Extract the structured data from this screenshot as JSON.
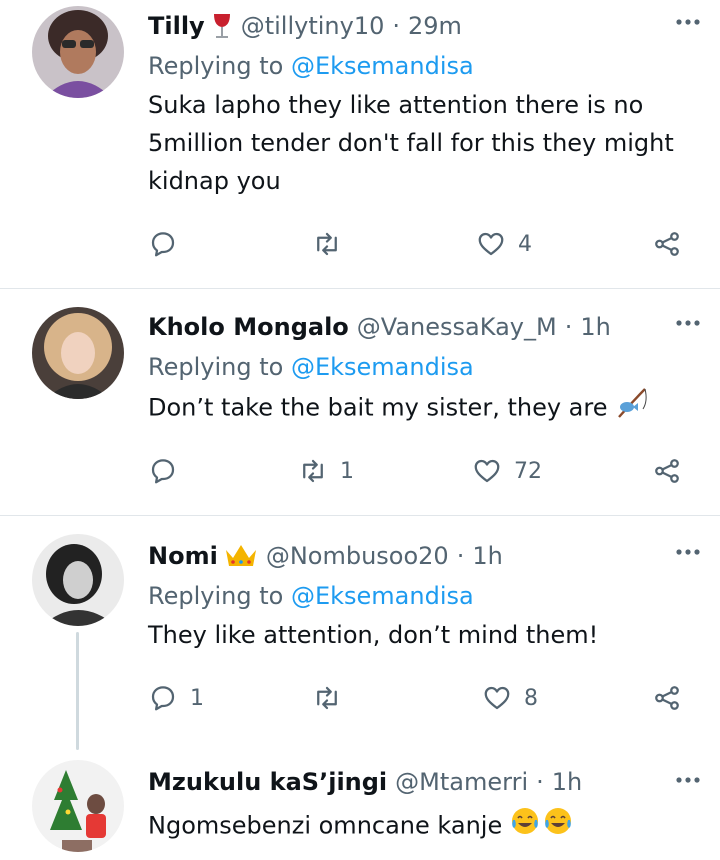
{
  "tweets": [
    {
      "name": "Tilly",
      "emoji": "wine-glass",
      "handle": "@tillytiny10",
      "time": "29m",
      "replying_label": "Replying to",
      "replying_to": "@Eksemandisa",
      "text": "Suka lapho they like attention there is no 5million tender don't fall for this they might kidnap you",
      "reply_count": "",
      "retweet_count": "",
      "like_count": "4"
    },
    {
      "name": "Kholo Mongalo",
      "emoji": "",
      "handle": "@VanessaKay_M",
      "time": "1h",
      "replying_label": "Replying to",
      "replying_to": "@Eksemandisa",
      "text": "Don’t take the bait my sister, they are",
      "text_emoji": "fishing-pole",
      "reply_count": "",
      "retweet_count": "1",
      "like_count": "72"
    },
    {
      "name": "Nomi",
      "emoji": "crown",
      "handle": "@Nombusoo20",
      "time": "1h",
      "replying_label": "Replying to",
      "replying_to": "@Eksemandisa",
      "text": "They like attention, don’t mind them!",
      "reply_count": "1",
      "retweet_count": "",
      "like_count": "8"
    },
    {
      "name": "Mzukulu kaS’jingi",
      "emoji": "",
      "handle": "@Mtamerri",
      "time": "1h",
      "text": "Ngomsebenzi omncane kanje",
      "text_emoji": "tears-of-joy x2"
    }
  ],
  "separator": "·",
  "colors": {
    "text": "#0f1419",
    "secondary": "#536471",
    "link": "#1d9bf0",
    "divider": "#e1e6ea"
  },
  "icons": [
    "reply-icon",
    "retweet-icon",
    "like-icon",
    "share-icon",
    "more-icon"
  ]
}
